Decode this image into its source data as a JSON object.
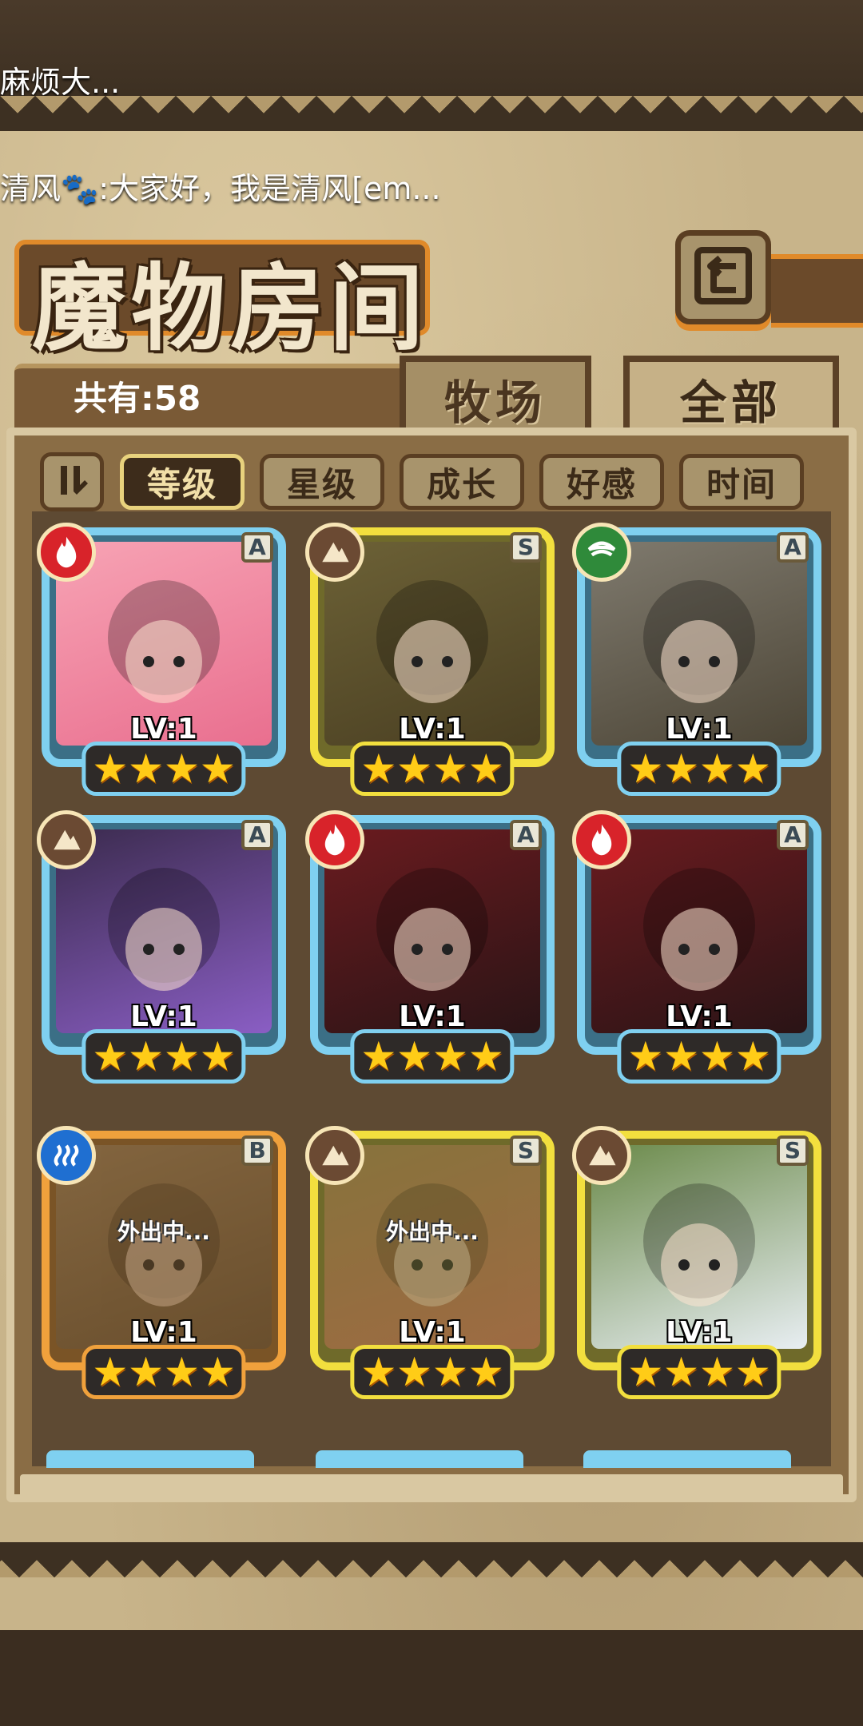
{
  "chat": {
    "line1": "麻烦大...",
    "line2": "清风🐾:大家好，我是清风[em..."
  },
  "header": {
    "title": "魔物房间",
    "back_icon": "return-icon",
    "count_label": "共有:58"
  },
  "tabs": [
    {
      "label": "牧场",
      "active": false
    },
    {
      "label": "全部",
      "active": true
    }
  ],
  "sort": {
    "toggle_icon": "sort-order-icon",
    "buttons": [
      {
        "label": "等级",
        "active": true
      },
      {
        "label": "星级",
        "active": false
      },
      {
        "label": "成长",
        "active": false
      },
      {
        "label": "好感",
        "active": false
      },
      {
        "label": "时间",
        "active": false
      }
    ]
  },
  "colors": {
    "accent_orange": "#e08a2a",
    "frame_blue": "#7fd0f0",
    "frame_gold": "#f2df3e",
    "frame_orange": "#f0a13c",
    "element_fire": "#d8232a",
    "element_earth": "#6b4a33",
    "element_wind": "#2f8a3a",
    "element_water": "#1f6fd1"
  },
  "monsters": [
    {
      "rank": "A",
      "element": "fire-icon",
      "level": "LV:1",
      "stars": 4,
      "status": ""
    },
    {
      "rank": "S",
      "element": "earth-icon",
      "level": "LV:1",
      "stars": 4,
      "status": ""
    },
    {
      "rank": "A",
      "element": "wind-icon",
      "level": "LV:1",
      "stars": 4,
      "status": ""
    },
    {
      "rank": "A",
      "element": "earth-icon",
      "level": "LV:1",
      "stars": 4,
      "status": ""
    },
    {
      "rank": "A",
      "element": "fire-icon",
      "level": "LV:1",
      "stars": 4,
      "status": ""
    },
    {
      "rank": "A",
      "element": "fire-icon",
      "level": "LV:1",
      "stars": 4,
      "status": ""
    },
    {
      "rank": "B",
      "element": "water-icon",
      "level": "LV:1",
      "stars": 4,
      "status": "外出中..."
    },
    {
      "rank": "S",
      "element": "earth-icon",
      "level": "LV:1",
      "stars": 4,
      "status": "外出中..."
    },
    {
      "rank": "S",
      "element": "earth-icon",
      "level": "LV:1",
      "stars": 4,
      "status": ""
    }
  ]
}
